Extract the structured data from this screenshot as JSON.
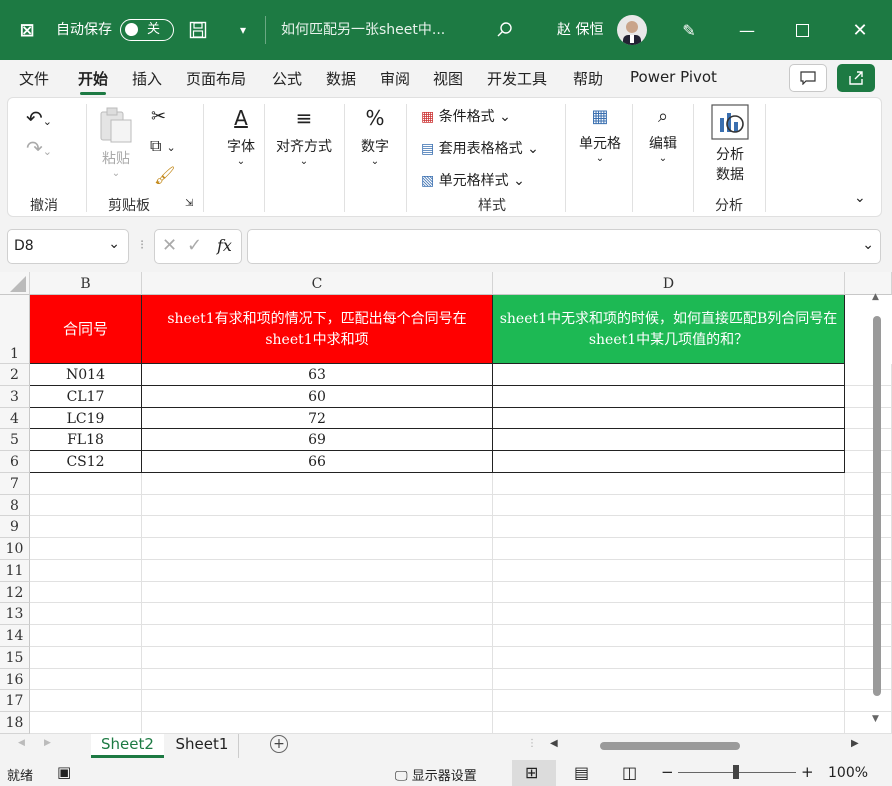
{
  "titlebar": {
    "autosave_label": "自动保存",
    "autosave_state": "关",
    "filename": "如何匹配另一张sheet中...",
    "user": "赵 保恒",
    "accent": "#1d7a43"
  },
  "menu": [
    "文件",
    "开始",
    "插入",
    "页面布局",
    "公式",
    "数据",
    "审阅",
    "视图",
    "开发工具",
    "帮助",
    "Power Pivot"
  ],
  "ribbon": {
    "undo_group": "撤消",
    "paste": "粘贴",
    "clipboard_group": "剪贴板",
    "font": "字体",
    "align": "对齐方式",
    "number": "数字",
    "cond_format": "条件格式",
    "table_format": "套用表格格式",
    "cell_style": "单元格样式",
    "style_group": "样式",
    "cells": "单元格",
    "edit": "编辑",
    "analyze_line1": "分析",
    "analyze_line2": "数据",
    "analyze_group": "分析"
  },
  "formula_bar": {
    "name_box": "D8",
    "fx": "fx",
    "content": ""
  },
  "columns": [
    "B",
    "C",
    "D"
  ],
  "rows": [
    "1",
    "2",
    "3",
    "4",
    "5",
    "6",
    "7",
    "8",
    "9",
    "10",
    "11",
    "12",
    "13",
    "14",
    "15",
    "16",
    "17",
    "18"
  ],
  "header_cells": {
    "B1": "合同号",
    "C1": "sheet1有求和项的情况下，匹配出每个合同号在sheet1中求和项",
    "D1": "sheet1中无求和项的时候，如何直接匹配B列合同号在sheet1中某几项值的和？",
    "C1_color": "#ff0000",
    "D1_color": "#1db954"
  },
  "data_rows": [
    {
      "id": "N014",
      "value": "63"
    },
    {
      "id": "CL17",
      "value": "60"
    },
    {
      "id": "LC19",
      "value": "72"
    },
    {
      "id": "FL18",
      "value": "69"
    },
    {
      "id": "CS12",
      "value": "66"
    }
  ],
  "sheets": {
    "tab1": "Sheet2",
    "tab2": "Sheet1",
    "active": "Sheet2"
  },
  "status": {
    "ready": "就绪",
    "display": "显示器设置",
    "zoom": "100%"
  }
}
